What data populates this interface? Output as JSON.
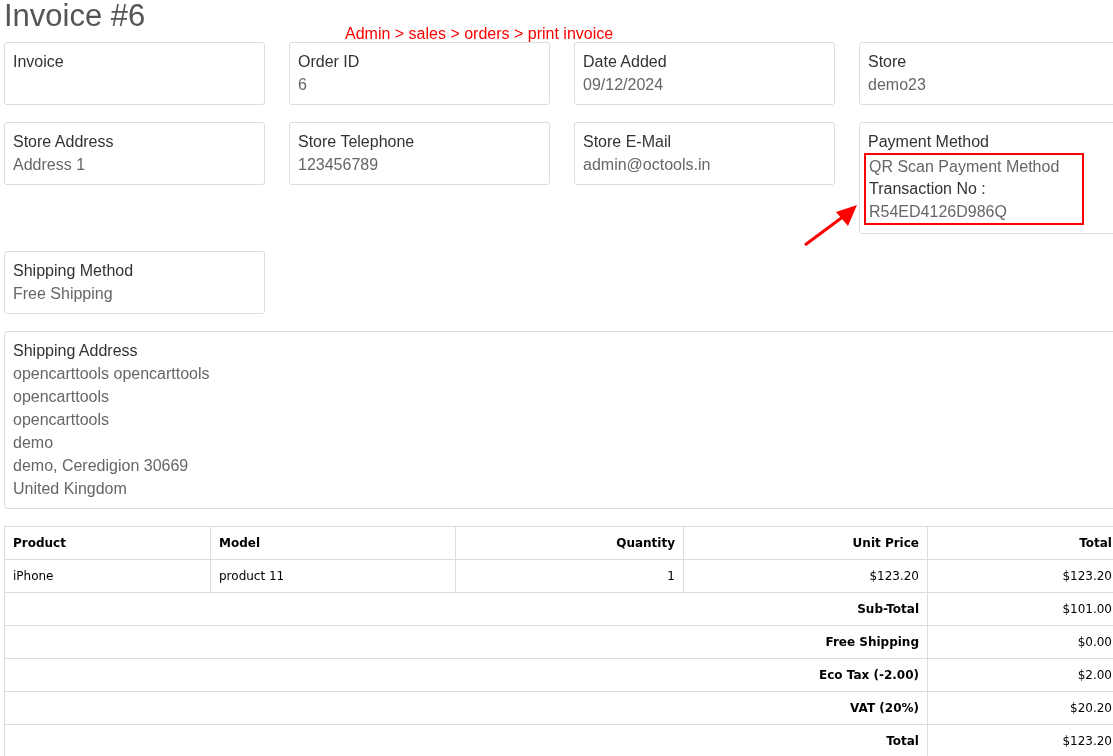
{
  "title": "Invoice #6",
  "annotation": {
    "text": "Admin > sales > orders > print invoice"
  },
  "cards": [
    {
      "label": "Invoice"
    },
    {
      "label": "Order ID",
      "lines": [
        {
          "kind": "value",
          "text": "6"
        }
      ]
    },
    {
      "label": "Date Added",
      "lines": [
        {
          "kind": "value",
          "text": "09/12/2024"
        }
      ]
    },
    {
      "label": "Store",
      "lines": [
        {
          "kind": "value",
          "text": "demo23"
        }
      ]
    },
    {
      "label": "Store Address",
      "lines": [
        {
          "kind": "value",
          "text": "Address 1"
        }
      ]
    },
    {
      "label": "Store Telephone",
      "lines": [
        {
          "kind": "value",
          "text": "123456789"
        }
      ]
    },
    {
      "label": "Store E-Mail",
      "lines": [
        {
          "kind": "value",
          "text": "admin@octools.in"
        }
      ]
    },
    {
      "label": "Payment Method",
      "highlighted": true,
      "lines": [
        {
          "kind": "value",
          "text": "QR Scan Payment Method"
        },
        {
          "kind": "label",
          "text": "Transaction No :"
        },
        {
          "kind": "value",
          "text": "R54ED4126D986Q"
        }
      ]
    },
    {
      "label": "Shipping Method",
      "lines": [
        {
          "kind": "value",
          "text": "Free Shipping"
        }
      ]
    }
  ],
  "shipping_address": {
    "label": "Shipping Address",
    "lines": [
      {
        "kind": "value",
        "text": "opencarttools opencarttools"
      },
      {
        "kind": "value",
        "text": "opencarttools"
      },
      {
        "kind": "value",
        "text": "opencarttools"
      },
      {
        "kind": "value",
        "text": "demo"
      },
      {
        "kind": "value",
        "text": "demo, Ceredigion 30669"
      },
      {
        "kind": "value",
        "text": "United Kingdom"
      }
    ]
  },
  "table": {
    "columns": [
      "Product",
      "Model",
      "Quantity",
      "Unit Price",
      "Total"
    ],
    "rows": [
      [
        "iPhone",
        "product 11",
        "1",
        "$123.20",
        "$123.20"
      ]
    ],
    "totals": [
      {
        "label": "Sub-Total",
        "value": "$101.00"
      },
      {
        "label": "Free Shipping",
        "value": "$0.00"
      },
      {
        "label": "Eco Tax (-2.00)",
        "value": "$2.00"
      },
      {
        "label": "VAT (20%)",
        "value": "$20.20"
      },
      {
        "label": "Total",
        "value": "$123.20"
      }
    ]
  }
}
